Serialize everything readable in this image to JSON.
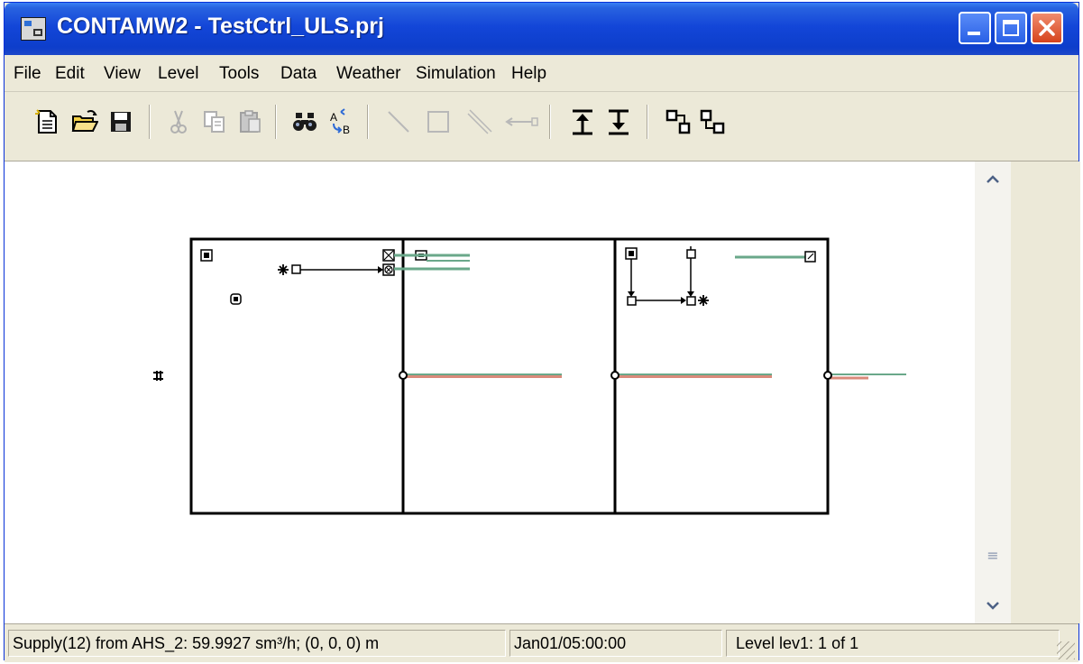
{
  "window": {
    "title": "CONTAMW2 - TestCtrl_ULS.prj"
  },
  "menu": [
    "File",
    "Edit",
    "View",
    "Level",
    "Tools",
    "Data",
    "Weather",
    "Simulation",
    "Help"
  ],
  "toolbar": {
    "buttons": [
      "new-icon",
      "open-icon",
      "save-icon",
      "cut-icon",
      "copy-icon",
      "paste-icon",
      "find-icon",
      "replace-icon",
      "draw-line-icon",
      "draw-rect-icon",
      "draw-diagonal-icon",
      "draw-leader-icon",
      "level-up-icon",
      "level-down-icon",
      "copy-level-icon",
      "paste-level-icon"
    ]
  },
  "status": {
    "message": "Supply(12) from AHS_2:  59.9927 sm³/h; (0, 0, 0) m",
    "time": "Jan01/05:00:00",
    "level": "Level lev1: 1 of 1"
  },
  "colors": {
    "title_bar": "#0d3ecb",
    "duct_green": "#6aa88a",
    "duct_red": "#d98a7a"
  }
}
